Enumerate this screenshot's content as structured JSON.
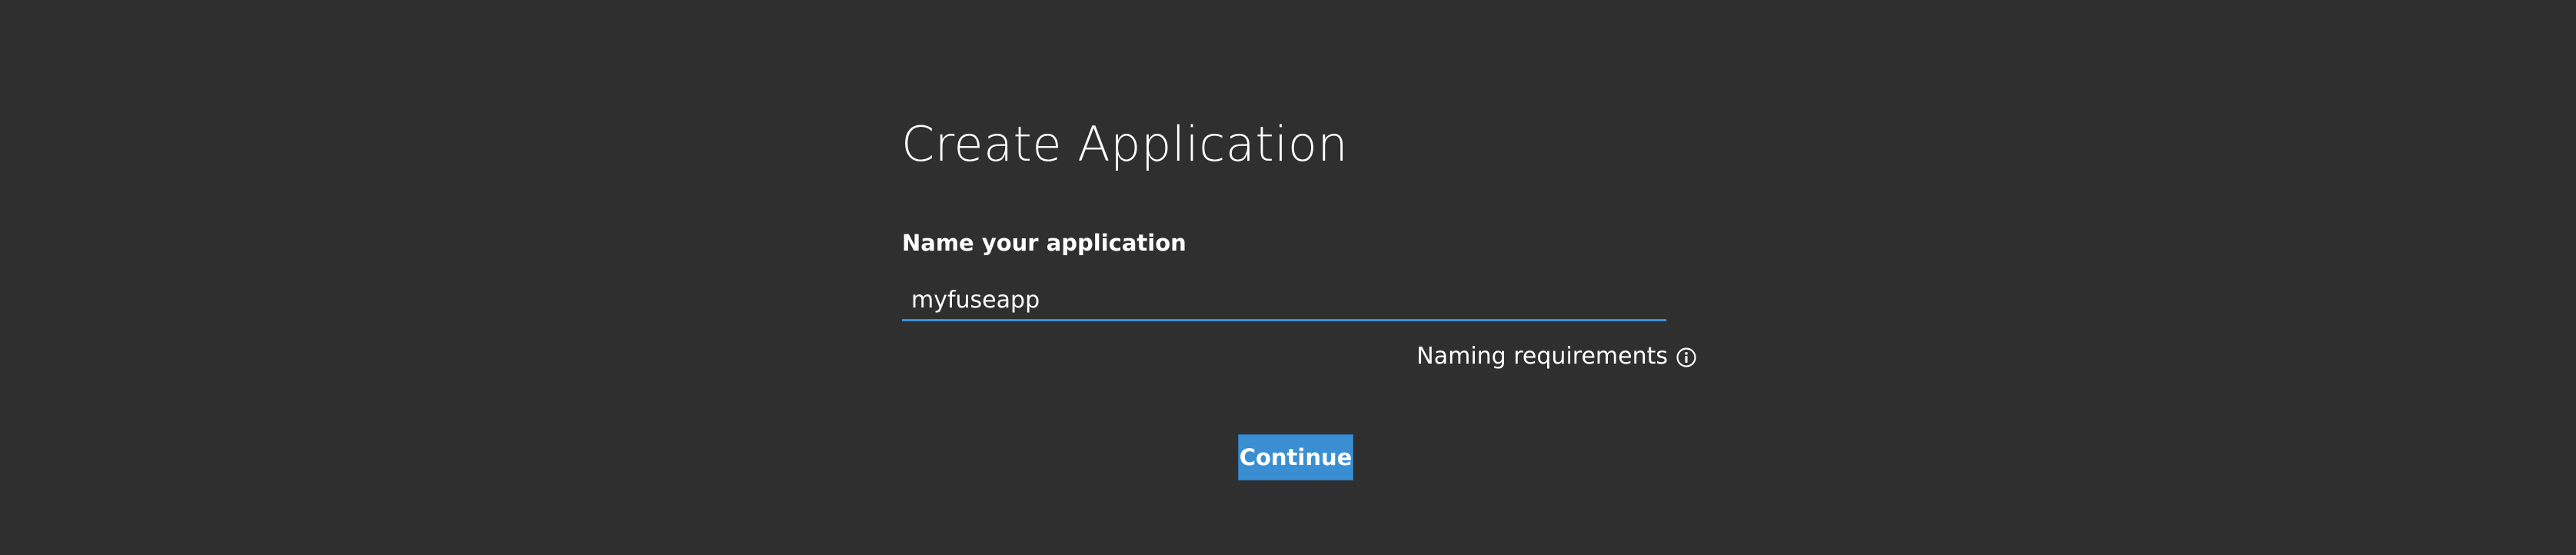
{
  "page": {
    "title": "Create Application"
  },
  "form": {
    "name_label": "Name your application",
    "name_value": "myfuseapp",
    "naming_requirements_label": "Naming requirements",
    "naming_requirements_icon": "info-icon",
    "continue_label": "Continue"
  },
  "colors": {
    "background": "#2f2f2f",
    "accent": "#3a8fd3",
    "text": "#ffffff"
  }
}
